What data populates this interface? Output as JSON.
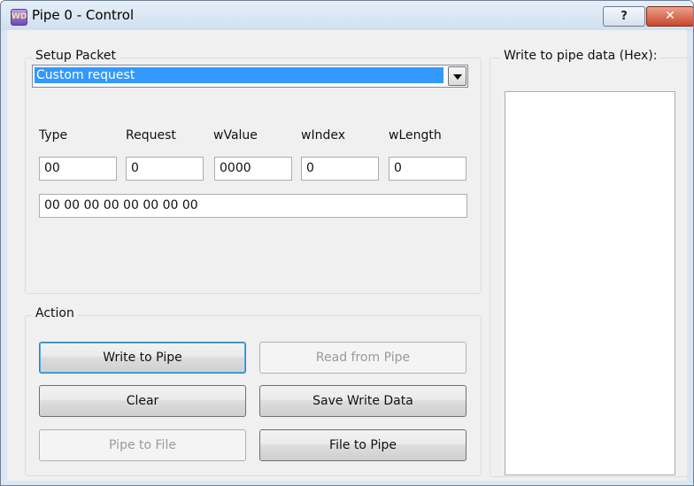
{
  "window": {
    "app_icon_text": "WD",
    "title": "Pipe 0 - Control",
    "help_label": "?",
    "close_label": "✕"
  },
  "setup": {
    "group_label": "Setup Packet",
    "request_combo_value": "Custom request",
    "columns": [
      "Type",
      "Request",
      "wValue",
      "wIndex",
      "wLength"
    ],
    "values": {
      "type": "00",
      "request": "0",
      "wvalue": "0000",
      "windex": "0",
      "wlength": "0"
    },
    "raw_bytes": "00 00 00 00 00 00 00 00"
  },
  "action": {
    "group_label": "Action",
    "write_to_pipe": "Write to Pipe",
    "read_from_pipe": "Read from Pipe",
    "clear": "Clear",
    "save_write_data": "Save Write Data",
    "pipe_to_file": "Pipe to File",
    "file_to_pipe": "File to Pipe"
  },
  "write_data": {
    "group_label": "Write to pipe data (Hex):",
    "value": ""
  }
}
